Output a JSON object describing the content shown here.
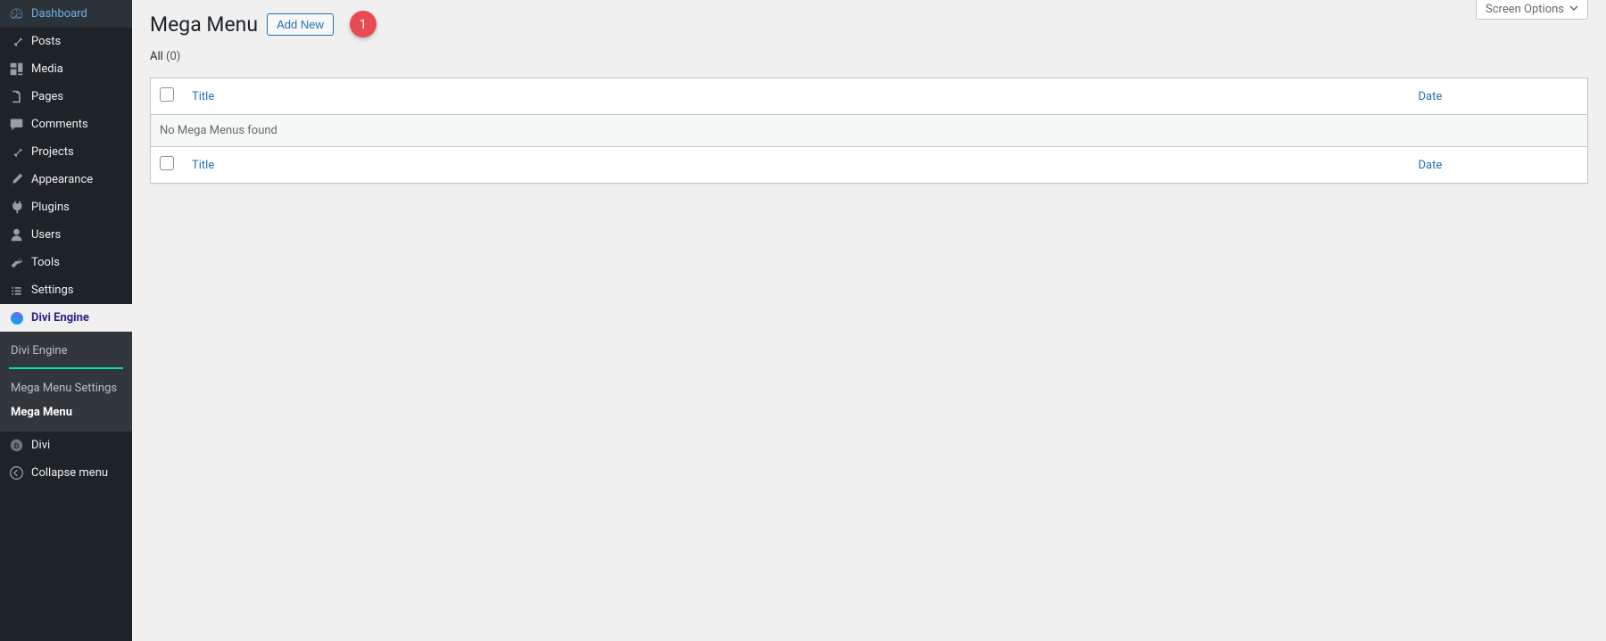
{
  "sidebar": {
    "items": [
      {
        "label": "Dashboard",
        "icon": "dashboard-icon"
      },
      {
        "label": "Posts",
        "icon": "pin-icon"
      },
      {
        "label": "Media",
        "icon": "media-icon"
      },
      {
        "label": "Pages",
        "icon": "page-icon"
      },
      {
        "label": "Comments",
        "icon": "comment-icon"
      },
      {
        "label": "Projects",
        "icon": "pin-icon"
      },
      {
        "label": "Appearance",
        "icon": "brush-icon"
      },
      {
        "label": "Plugins",
        "icon": "plugin-icon"
      },
      {
        "label": "Users",
        "icon": "user-icon"
      },
      {
        "label": "Tools",
        "icon": "tools-icon"
      },
      {
        "label": "Settings",
        "icon": "settings-icon"
      },
      {
        "label": "Divi Engine",
        "icon": "divi-engine-icon"
      },
      {
        "label": "Divi",
        "icon": "divi-icon"
      },
      {
        "label": "Collapse menu",
        "icon": "collapse-icon"
      }
    ],
    "submenu": {
      "items": [
        {
          "label": "Divi Engine"
        },
        {
          "label": "Mega Menu Settings"
        },
        {
          "label": "Mega Menu"
        }
      ]
    }
  },
  "header": {
    "title": "Mega Menu",
    "add_new": "Add New",
    "callout": "1"
  },
  "screen_options": "Screen Options",
  "filters": {
    "all_label": "All",
    "all_count": "(0)"
  },
  "table": {
    "columns": {
      "title": "Title",
      "date": "Date"
    },
    "empty": "No Mega Menus found"
  }
}
